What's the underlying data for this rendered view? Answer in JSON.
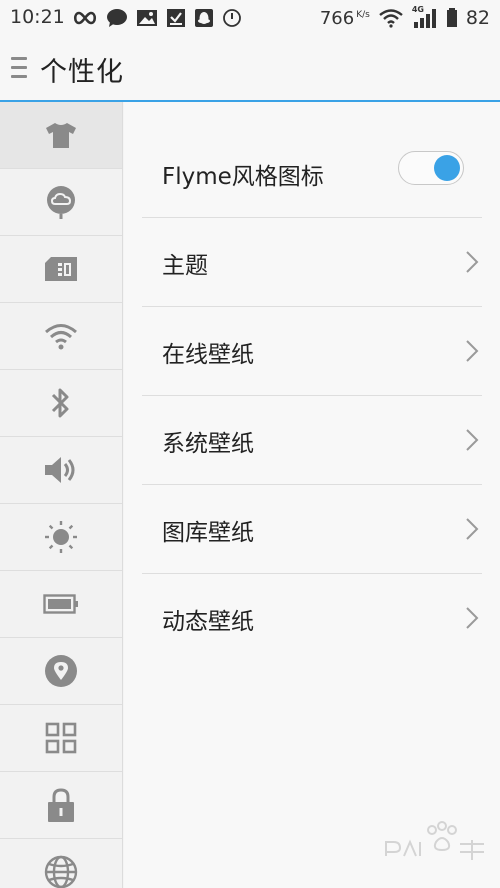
{
  "status_bar": {
    "time": "10:21",
    "speed_value": "766",
    "speed_unit": "K/s",
    "network_label": "4G",
    "battery": "82",
    "left_icons": [
      "infinity-icon",
      "chat-bubble-icon",
      "image-icon",
      "download-check-icon",
      "qq-penguin-icon",
      "clock-circle-icon"
    ],
    "right_icons": [
      "wifi-icon",
      "cell-signal-icon"
    ]
  },
  "header": {
    "title": "个性化",
    "menu_icon": "menu-lines-icon"
  },
  "sidebar": {
    "items": [
      {
        "icon": "tshirt-icon",
        "active": true
      },
      {
        "icon": "cloud-account-icon",
        "active": false
      },
      {
        "icon": "sim-card-icon",
        "active": false
      },
      {
        "icon": "wifi-icon",
        "active": false
      },
      {
        "icon": "bluetooth-icon",
        "active": false
      },
      {
        "icon": "volume-icon",
        "active": false
      },
      {
        "icon": "brightness-icon",
        "active": false
      },
      {
        "icon": "battery-icon",
        "active": false
      },
      {
        "icon": "location-pin-icon",
        "active": false
      },
      {
        "icon": "apps-grid-icon",
        "active": false
      },
      {
        "icon": "lock-icon",
        "active": false
      },
      {
        "icon": "globe-icon",
        "active": false
      }
    ]
  },
  "main": {
    "rows": [
      {
        "label": "Flyme风格图标",
        "type": "toggle",
        "value": true
      },
      {
        "label": "主题",
        "type": "link"
      },
      {
        "label": "在线壁纸",
        "type": "link"
      },
      {
        "label": "系统壁纸",
        "type": "link"
      },
      {
        "label": "图库壁纸",
        "type": "link"
      },
      {
        "label": "动态壁纸",
        "type": "link"
      }
    ]
  },
  "colors": {
    "accent": "#3aa2e6",
    "icon_gray": "#8a8a8a",
    "text": "#222222"
  }
}
